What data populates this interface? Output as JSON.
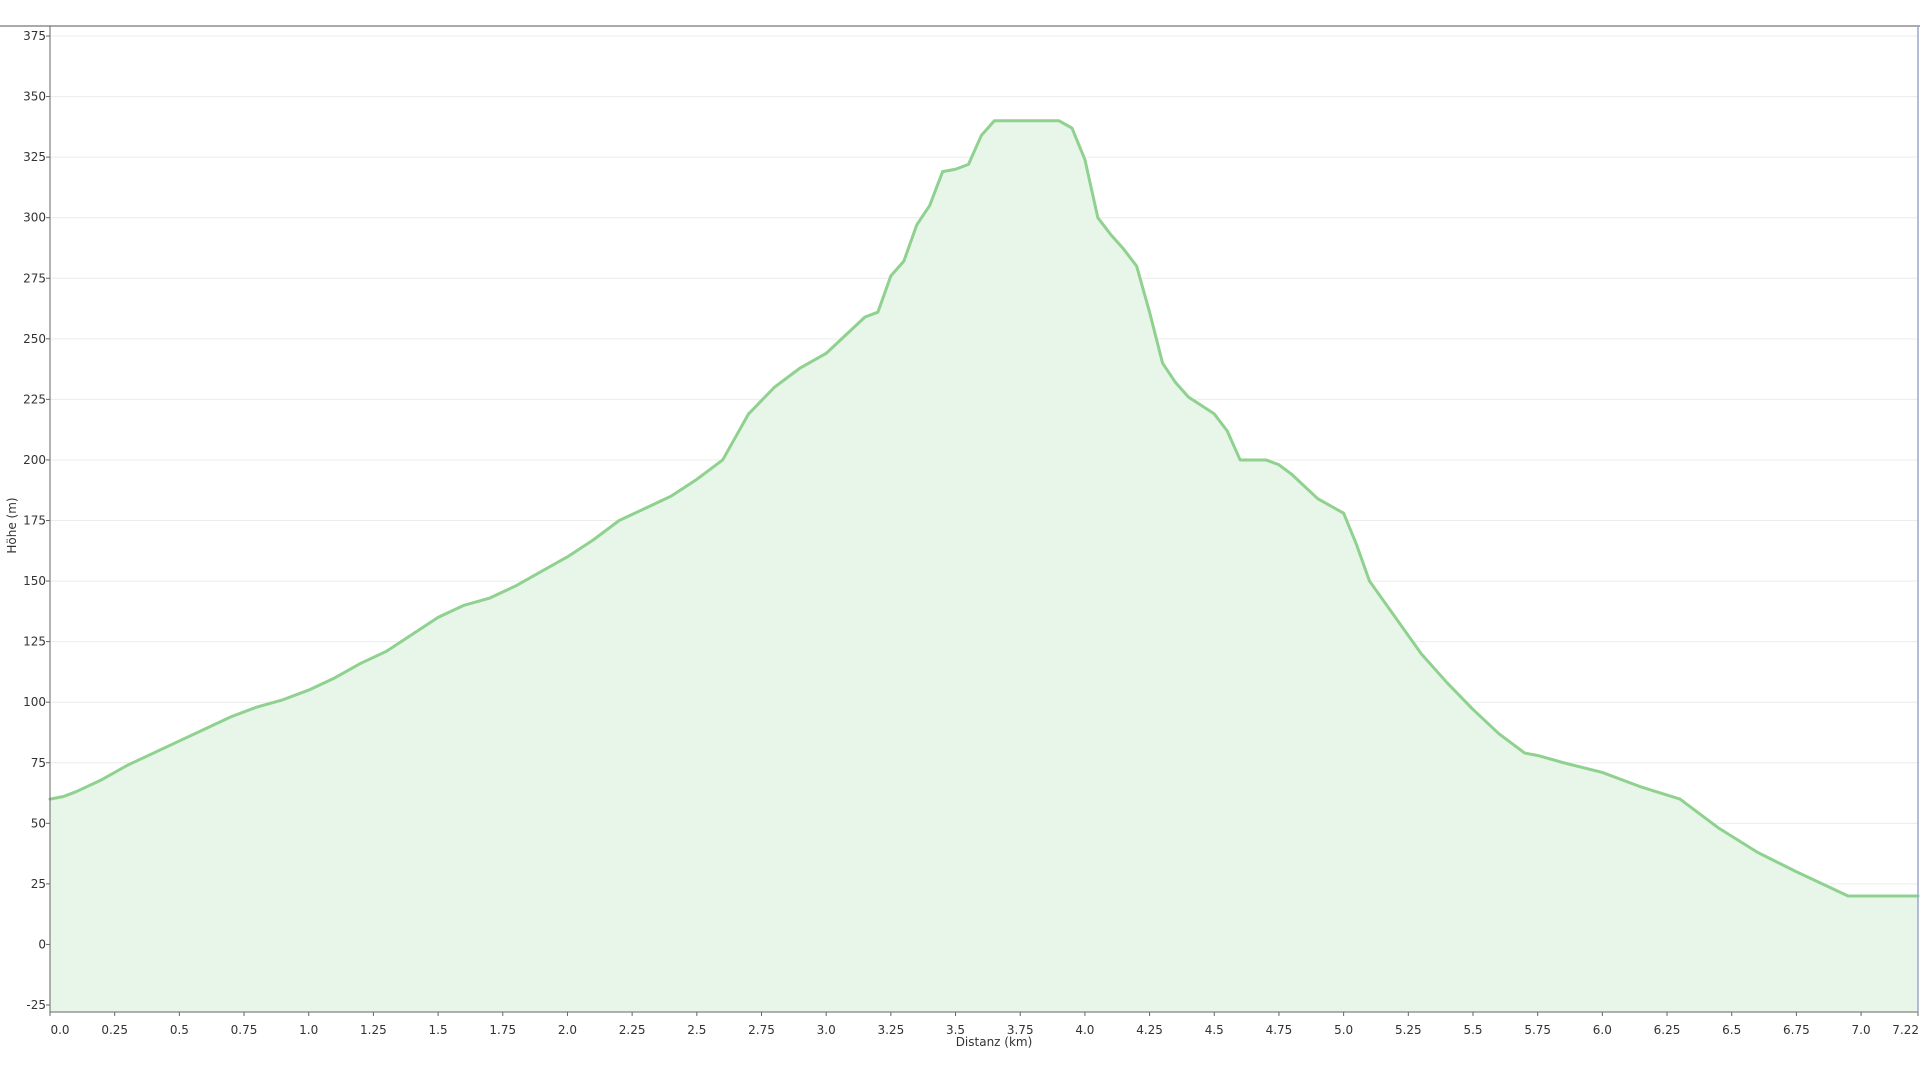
{
  "chart_data": {
    "type": "area",
    "title": "",
    "xlabel": "Distanz (km)",
    "ylabel": "Höhe (m)",
    "xlim": [
      0,
      7.22
    ],
    "ylim": [
      -25,
      375
    ],
    "grid": true,
    "x_ticks": [
      0.0,
      0.25,
      0.5,
      0.75,
      1.0,
      1.25,
      1.5,
      1.75,
      2.0,
      2.25,
      2.5,
      2.75,
      3.0,
      3.25,
      3.5,
      3.75,
      4.0,
      4.25,
      4.5,
      4.75,
      5.0,
      5.25,
      5.5,
      5.75,
      6.0,
      6.25,
      6.5,
      6.75,
      7.0,
      7.22
    ],
    "x_tick_labels": [
      "0.0",
      "0.25",
      "0.5",
      "0.75",
      "1.0",
      "1.25",
      "1.5",
      "1.75",
      "2.0",
      "2.25",
      "2.5",
      "2.75",
      "3.0",
      "3.25",
      "3.5",
      "3.75",
      "4.0",
      "4.25",
      "4.5",
      "4.75",
      "5.0",
      "5.25",
      "5.5",
      "5.75",
      "6.0",
      "6.25",
      "6.5",
      "6.75",
      "7.0",
      "7.22"
    ],
    "y_ticks": [
      -25,
      0,
      25,
      50,
      75,
      100,
      125,
      150,
      175,
      200,
      225,
      250,
      275,
      300,
      325,
      350,
      375
    ],
    "y_tick_labels": [
      "-25",
      "0",
      "25",
      "50",
      "75",
      "100",
      "125",
      "150",
      "175",
      "200",
      "225",
      "250",
      "275",
      "300",
      "325",
      "350",
      "375"
    ],
    "colors": {
      "line": "#8fd18f",
      "fill": "#e8f5e9",
      "grid": "#ececec",
      "axis": "#666666"
    },
    "series": [
      {
        "x": [
          0.0,
          0.05,
          0.1,
          0.2,
          0.3,
          0.4,
          0.5,
          0.6,
          0.7,
          0.8,
          0.9,
          1.0,
          1.1,
          1.2,
          1.3,
          1.4,
          1.5,
          1.6,
          1.7,
          1.8,
          1.9,
          2.0,
          2.1,
          2.2,
          2.3,
          2.4,
          2.5,
          2.6,
          2.7,
          2.8,
          2.9,
          3.0,
          3.1,
          3.15,
          3.2,
          3.25,
          3.3,
          3.35,
          3.4,
          3.45,
          3.5,
          3.55,
          3.6,
          3.65,
          3.7,
          3.8,
          3.9,
          3.95,
          4.0,
          4.05,
          4.1,
          4.15,
          4.2,
          4.25,
          4.3,
          4.35,
          4.4,
          4.5,
          4.55,
          4.6,
          4.65,
          4.7,
          4.75,
          4.8,
          4.9,
          5.0,
          5.05,
          5.1,
          5.2,
          5.3,
          5.4,
          5.5,
          5.6,
          5.7,
          5.75,
          5.85,
          6.0,
          6.15,
          6.3,
          6.45,
          6.6,
          6.75,
          6.85,
          6.95,
          7.0,
          7.1,
          7.22
        ],
        "y": [
          60,
          61,
          63,
          68,
          74,
          79,
          84,
          89,
          94,
          98,
          101,
          105,
          110,
          116,
          121,
          128,
          135,
          140,
          143,
          148,
          154,
          160,
          167,
          175,
          180,
          185,
          192,
          200,
          219,
          230,
          238,
          244,
          254,
          259,
          261,
          276,
          282,
          297,
          305,
          319,
          320,
          322,
          334,
          340,
          340,
          340,
          340,
          337,
          324,
          300,
          293,
          287,
          280,
          261,
          240,
          232,
          226,
          219,
          212,
          200,
          200,
          200,
          198,
          194,
          184,
          178,
          165,
          150,
          135,
          120,
          108,
          97,
          87,
          79,
          78,
          75,
          71,
          65,
          60,
          48,
          38,
          30,
          25,
          20,
          20,
          20,
          20
        ]
      }
    ]
  }
}
